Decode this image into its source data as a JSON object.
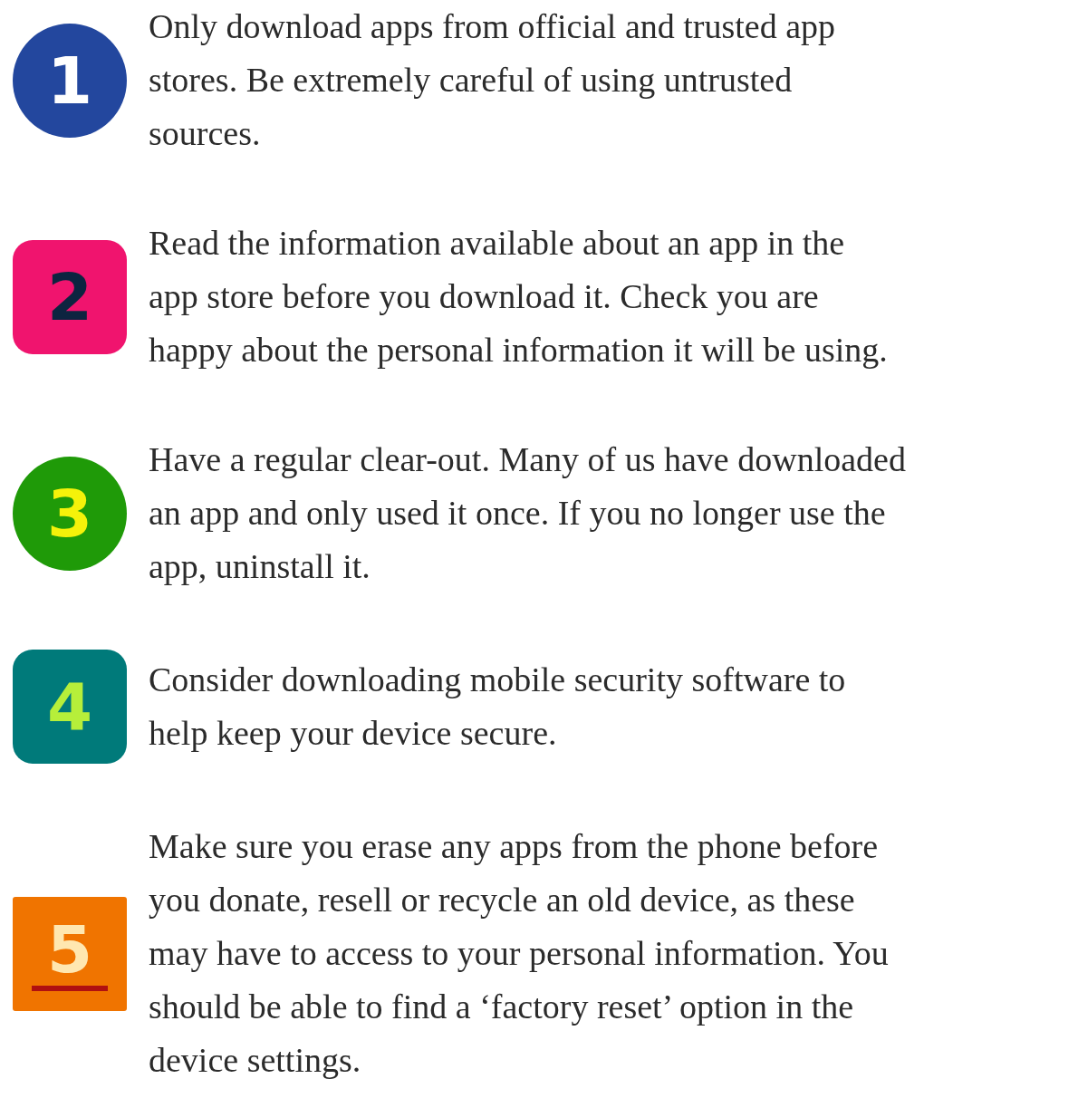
{
  "tips": [
    {
      "number": "1",
      "kind": "circle",
      "color": "#23479e",
      "lines": [
        "Only download apps from official and trusted app",
        "stores. Be extremely careful of using untrusted",
        "sources."
      ]
    },
    {
      "number": "2",
      "kind": "rounded",
      "color": "#f0146e",
      "lines": [
        "Read the information available about an app in the",
        "app store before you download it. Check you are",
        "happy about the personal information it will be using."
      ]
    },
    {
      "number": "3",
      "kind": "circle",
      "color": "#1f9a08",
      "lines": [
        "Have a regular clear-out. Many of us have downloaded",
        "an app and only used it once. If you no longer use the",
        "app, uninstall it."
      ]
    },
    {
      "number": "4",
      "kind": "rounded",
      "color": "#007a7a",
      "lines": [
        "Consider downloading mobile security software to",
        "help keep your device secure."
      ]
    },
    {
      "number": "5",
      "kind": "square",
      "color": "#f07400",
      "lines": [
        "Make sure you erase any apps from the phone before",
        "you donate, resell or recycle an old device, as these",
        "may have to access to your personal information. You",
        "should be able to find a ‘factory reset’ option in the",
        "device settings."
      ]
    }
  ]
}
